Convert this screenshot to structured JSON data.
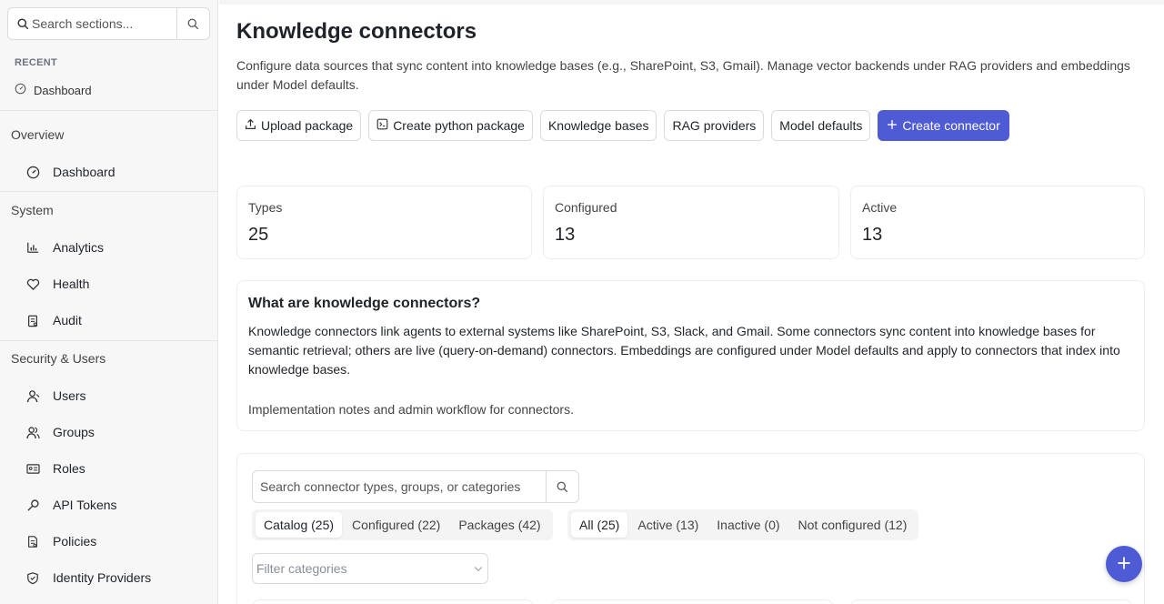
{
  "sidebar": {
    "search": {
      "placeholder": "Search sections..."
    },
    "recent": {
      "label": "RECENT",
      "items": [
        {
          "label": "Dashboard",
          "icon": "gauge-icon"
        }
      ]
    },
    "sections": [
      {
        "title": "Overview",
        "items": [
          {
            "label": "Dashboard",
            "icon": "gauge-icon"
          }
        ]
      },
      {
        "title": "System",
        "items": [
          {
            "label": "Analytics",
            "icon": "bar-chart-icon"
          },
          {
            "label": "Health",
            "icon": "heart-icon"
          },
          {
            "label": "Audit",
            "icon": "clipboard-icon"
          }
        ]
      },
      {
        "title": "Security & Users",
        "items": [
          {
            "label": "Users",
            "icon": "user-icon"
          },
          {
            "label": "Groups",
            "icon": "users-icon"
          },
          {
            "label": "Roles",
            "icon": "id-card-icon"
          },
          {
            "label": "API Tokens",
            "icon": "key-icon"
          },
          {
            "label": "Policies",
            "icon": "document-icon"
          },
          {
            "label": "Identity Providers",
            "icon": "shield-icon"
          }
        ]
      }
    ]
  },
  "main": {
    "title": "Knowledge connectors",
    "description": "Configure data sources that sync content into knowledge bases (e.g., SharePoint, S3, Gmail). Manage vector backends under RAG providers and embeddings under Model defaults.",
    "buttons": {
      "upload": "Upload package",
      "create_python": "Create python package",
      "knowledge_bases": "Knowledge bases",
      "rag_providers": "RAG providers",
      "model_defaults": "Model defaults",
      "create_connector": "Create connector"
    },
    "stats": [
      {
        "label": "Types",
        "value": "25"
      },
      {
        "label": "Configured",
        "value": "13"
      },
      {
        "label": "Active",
        "value": "13"
      }
    ],
    "info": {
      "title": "What are knowledge connectors?",
      "body": "Knowledge connectors link agents to external systems like SharePoint, S3, Slack, and Gmail. Some connectors sync content into knowledge bases for semantic retrieval; others are live (query-on-demand) connectors. Embeddings are configured under Model defaults and apply to connectors that index into knowledge bases.",
      "note": "Implementation notes and admin workflow for connectors."
    },
    "catalog": {
      "search_placeholder": "Search connector types, groups, or categories",
      "view_tabs": [
        "Catalog (25)",
        "Configured (22)",
        "Packages (42)"
      ],
      "status_tabs": [
        "All (25)",
        "Active (13)",
        "Inactive (0)",
        "Not configured (12)"
      ],
      "filter_placeholder": "Filter categories"
    }
  },
  "colors": {
    "accent": "#4f5bd5"
  }
}
